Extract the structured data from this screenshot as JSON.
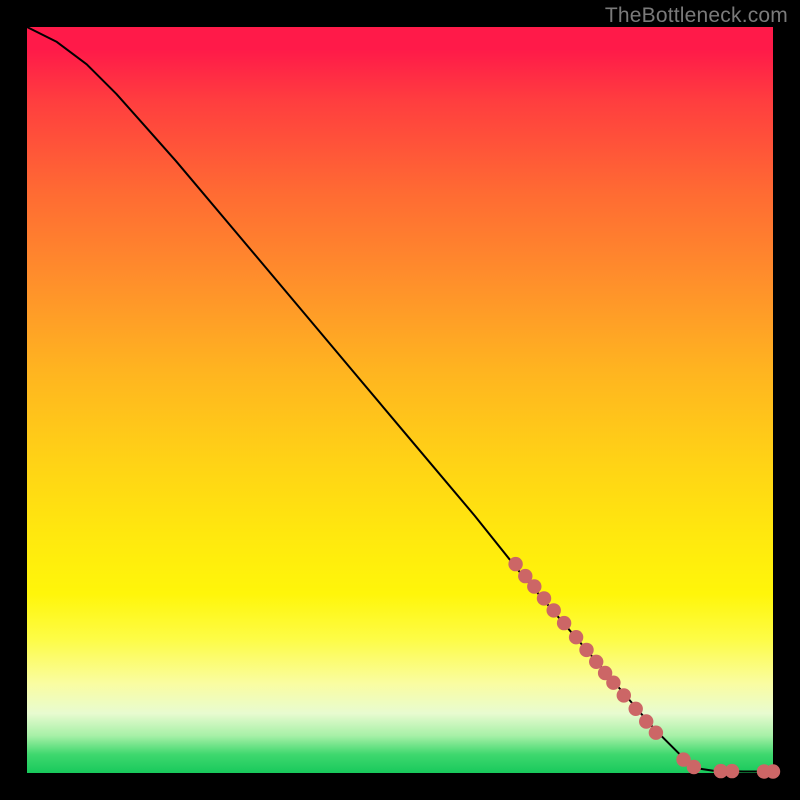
{
  "watermark": "TheBottleneck.com",
  "chart_data": {
    "type": "line",
    "title": "",
    "xlabel": "",
    "ylabel": "",
    "xlim": [
      0,
      100
    ],
    "ylim": [
      0,
      100
    ],
    "grid": false,
    "legend": false,
    "curve": [
      {
        "x": 0,
        "y": 100
      },
      {
        "x": 4,
        "y": 98
      },
      {
        "x": 8,
        "y": 95
      },
      {
        "x": 12,
        "y": 91
      },
      {
        "x": 16,
        "y": 86.5
      },
      {
        "x": 20,
        "y": 82
      },
      {
        "x": 28,
        "y": 72.5
      },
      {
        "x": 36,
        "y": 63
      },
      {
        "x": 44,
        "y": 53.5
      },
      {
        "x": 52,
        "y": 44
      },
      {
        "x": 60,
        "y": 34.5
      },
      {
        "x": 66,
        "y": 27
      },
      {
        "x": 72,
        "y": 20
      },
      {
        "x": 78,
        "y": 13
      },
      {
        "x": 84,
        "y": 6
      },
      {
        "x": 88,
        "y": 2
      },
      {
        "x": 90,
        "y": 0.6
      },
      {
        "x": 92,
        "y": 0.3
      },
      {
        "x": 96,
        "y": 0.2
      },
      {
        "x": 100,
        "y": 0.2
      }
    ],
    "markers": [
      {
        "x": 65.5,
        "y": 28.0
      },
      {
        "x": 66.8,
        "y": 26.4
      },
      {
        "x": 68.0,
        "y": 25.0
      },
      {
        "x": 69.3,
        "y": 23.4
      },
      {
        "x": 70.6,
        "y": 21.8
      },
      {
        "x": 72.0,
        "y": 20.1
      },
      {
        "x": 73.6,
        "y": 18.2
      },
      {
        "x": 75.0,
        "y": 16.5
      },
      {
        "x": 76.3,
        "y": 14.9
      },
      {
        "x": 77.5,
        "y": 13.4
      },
      {
        "x": 78.6,
        "y": 12.1
      },
      {
        "x": 80.0,
        "y": 10.4
      },
      {
        "x": 81.6,
        "y": 8.6
      },
      {
        "x": 83.0,
        "y": 6.9
      },
      {
        "x": 84.3,
        "y": 5.4
      },
      {
        "x": 88.0,
        "y": 1.8
      },
      {
        "x": 89.4,
        "y": 0.8
      },
      {
        "x": 93.0,
        "y": 0.25
      },
      {
        "x": 94.5,
        "y": 0.25
      },
      {
        "x": 98.8,
        "y": 0.2
      },
      {
        "x": 100.0,
        "y": 0.2
      }
    ],
    "marker_color": "#cc6666",
    "line_color": "#000000"
  }
}
